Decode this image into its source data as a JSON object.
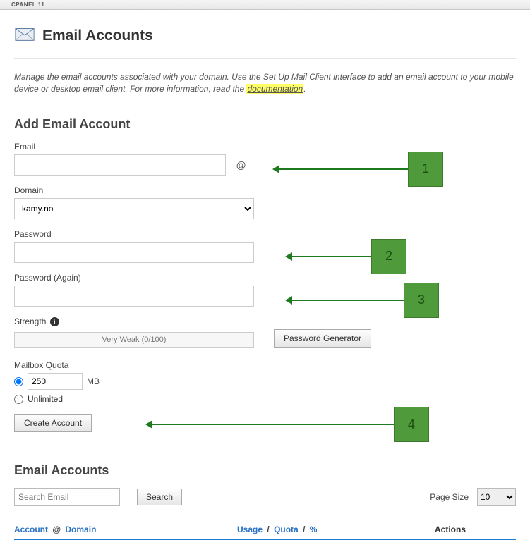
{
  "topbar": {
    "brand": "CPANEL 11"
  },
  "header": {
    "title": "Email Accounts"
  },
  "intro": {
    "text_a": "Manage the email accounts associated with your domain. Use the Set Up Mail Client interface to add an email account to your mobile device or desktop email client. For more information, read the ",
    "link": "documentation",
    "text_b": "."
  },
  "add": {
    "heading": "Add Email Account",
    "email_label": "Email",
    "email_value": "",
    "at": "@",
    "domain_label": "Domain",
    "domain_value": "kamy.no",
    "password_label": "Password",
    "password_value": "",
    "password_again_label": "Password (Again)",
    "password_again_value": "",
    "strength_label": "Strength",
    "strength_text": "Very Weak (0/100)",
    "pwgen_label": "Password Generator",
    "quota_label": "Mailbox Quota",
    "quota_value": "250",
    "quota_unit": "MB",
    "quota_unlimited": "Unlimited",
    "create_label": "Create Account"
  },
  "accounts": {
    "heading": "Email Accounts",
    "search_placeholder": "Search Email",
    "search_btn": "Search",
    "page_size_label": "Page Size",
    "page_size_value": "10",
    "cols": {
      "account": "Account",
      "at": "@",
      "domain": "Domain",
      "usage": "Usage",
      "quota": "Quota",
      "pct": "%",
      "sep": "/",
      "actions": "Actions"
    }
  },
  "annotations": {
    "n1": "1",
    "n2": "2",
    "n3": "3",
    "n4": "4"
  }
}
